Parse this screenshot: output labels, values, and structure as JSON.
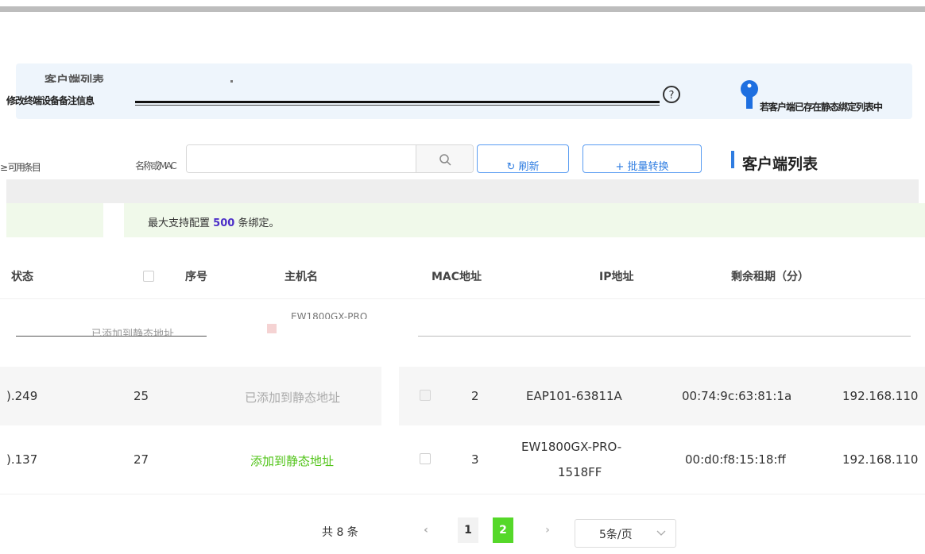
{
  "header": {
    "title": "客户端列表",
    "banner_text": "修改终端设备备注信息",
    "banner_tail": "若客户端已存在静态绑定列表中"
  },
  "toolbar": {
    "left_label": "≥ 可用条目",
    "sub_label": "名称或MAC",
    "search_placeholder": "",
    "refresh_label": "刷新",
    "batch_label": "批量转换",
    "list_heading": "客户端列表"
  },
  "notice": {
    "prefix": "最大支持配置",
    "count": "500",
    "suffix": "条绑定。"
  },
  "left_table": {
    "status_header": "状态",
    "rows": [
      {
        "ip": ").249",
        "seq": "25",
        "action": "已添加到静态地址",
        "action_type": "disabled"
      },
      {
        "ip": ").137",
        "seq": "27",
        "action": "添加到静态地址",
        "action_type": "link"
      }
    ],
    "ghost_action": "已添加到静态地址"
  },
  "table": {
    "headers": [
      "序号",
      "主机名",
      "MAC地址",
      "IP地址",
      "剩余租期（分）"
    ],
    "ghost_host": "EW1800GX-PRO",
    "rows": [
      {
        "seq": "2",
        "host": "EAP101-63811A",
        "mac": "00:74:9c:63:81:1a",
        "ip": "192.168.110"
      },
      {
        "seq": "3",
        "host_line1": "EW1800GX-PRO-",
        "host_line2": "1518FF",
        "mac": "00:d0:f8:15:18:ff",
        "ip": "192.168.110"
      }
    ]
  },
  "pagination": {
    "total": "共 8 条",
    "pages": [
      "1",
      "2"
    ],
    "current": "2",
    "page_size": "5条/页"
  },
  "colors": {
    "accent_blue": "#2f7de1",
    "success_green": "#52c41a",
    "page_active": "#55d829",
    "count_purple": "#4b2ec8"
  }
}
